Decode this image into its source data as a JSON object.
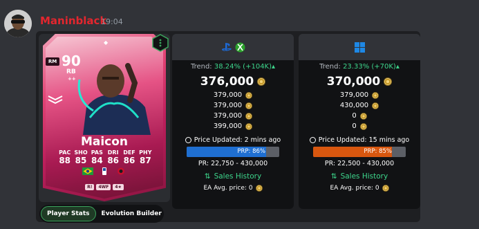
{
  "message": {
    "username": "Maninblack",
    "timestamp": "19:04"
  },
  "card": {
    "position_badge": "RM",
    "rating": "90",
    "position": "RB",
    "plus": "++",
    "name": "Maicon",
    "stats": [
      {
        "label": "PAC",
        "value": "88"
      },
      {
        "label": "SHO",
        "value": "85"
      },
      {
        "label": "PAS",
        "value": "84"
      },
      {
        "label": "DRI",
        "value": "86"
      },
      {
        "label": "DEF",
        "value": "86"
      },
      {
        "label": "PHY",
        "value": "87"
      }
    ],
    "tags": [
      "R!",
      "4WF",
      "4★"
    ],
    "colors": {
      "primary": "#e34576",
      "dark": "#8a1440"
    }
  },
  "tabs": {
    "player_stats": "Player Stats",
    "evolution_builder": "Evolution Builder"
  },
  "panels": [
    {
      "platform_icons": [
        "playstation-icon",
        "xbox-icon"
      ],
      "trend_label": "Trend:",
      "trend_value": "38.24% (+104K)",
      "trend_arrow": "▴",
      "main_price": "376,000",
      "prices": [
        "379,000",
        "379,000",
        "379,000",
        "399,000"
      ],
      "updated": "Price Updated: 2 mins ago",
      "prp": "PRP: 86%",
      "prp_fraction": 0.86,
      "bar_color": "#1f6fd1",
      "range": "PR: 22,750 - 430,000",
      "sales": "Sales History",
      "ea_avg": "EA Avg. price: 0"
    },
    {
      "platform_icons": [
        "windows-icon"
      ],
      "trend_label": "Trend:",
      "trend_value": "23.33% (+70K)",
      "trend_arrow": "▴",
      "main_price": "370,000",
      "prices": [
        "379,000",
        "430,000",
        "0",
        "0"
      ],
      "updated": "Price Updated: 15 mins ago",
      "prp": "PRP: 85%",
      "prp_fraction": 0.85,
      "bar_color": "#d8570f",
      "range": "PR: 22,500 - 430,000",
      "sales": "Sales History",
      "ea_avg": "EA Avg. price: 0"
    }
  ]
}
